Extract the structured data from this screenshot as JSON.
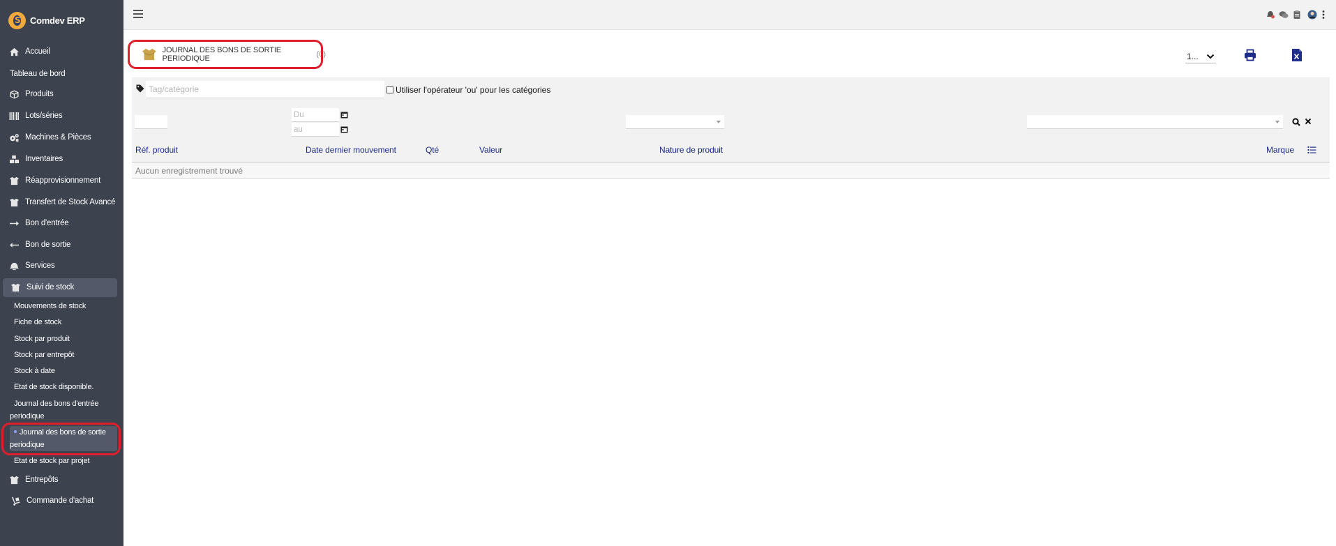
{
  "brand": {
    "name": "Comdev ERP"
  },
  "sidebar": {
    "items": [
      {
        "label": "Accueil",
        "icon": "home-icon"
      },
      {
        "label": "Tableau de bord",
        "icon": ""
      },
      {
        "label": "Produits",
        "icon": "cube-icon"
      },
      {
        "label": "Lots/séries",
        "icon": "barcode-icon"
      },
      {
        "label": "Machines & Pièces",
        "icon": "cogs-icon"
      },
      {
        "label": "Inventaires",
        "icon": "boxes-icon"
      },
      {
        "label": "Réapprovisionnement",
        "icon": "box-open-icon"
      },
      {
        "label": "Transfert de Stock Avancé",
        "icon": "box-open-icon"
      },
      {
        "label": "Bon d'entrée",
        "icon": "arrow-right-icon"
      },
      {
        "label": "Bon de sortie",
        "icon": "arrow-left-icon"
      },
      {
        "label": "Services",
        "icon": "bell-icon"
      },
      {
        "label": "Suivi de stock",
        "icon": "box-open-icon"
      },
      {
        "label": "Entrepôts",
        "icon": "box-open-icon"
      },
      {
        "label": "Commande d'achat",
        "icon": "dolly-icon"
      }
    ],
    "sub_items": [
      "Mouvements de stock",
      "Fiche de stock",
      "Stock par produit",
      "Stock par entrepôt",
      "Stock à date",
      "Etat de stock disponible.",
      "Journal des bons d'entrée periodique",
      "Journal des bons de sortie periodique",
      "Etat de stock par projet"
    ]
  },
  "page": {
    "title": "JOURNAL DES BONS DE SORTIE PERIODIQUE",
    "count": "(0)",
    "limit_value": "1..."
  },
  "filters": {
    "tag_placeholder": "Tag/catégorie",
    "or_operator_label": "Utiliser l'opérateur 'ou' pour les catégories",
    "date_from_placeholder": "Du",
    "date_to_placeholder": "au"
  },
  "table": {
    "columns": [
      "Réf. produit",
      "Date dernier mouvement",
      "Qté",
      "Valeur",
      "Nature de produit",
      "Marque"
    ],
    "empty_message": "Aucun enregistrement trouvé"
  },
  "colors": {
    "sidebar_bg": "#3d424f",
    "highlight": "#e01e2c",
    "column_header": "#1e2d8a",
    "icon_blue": "#1e2d8a",
    "box_icon": "#c9a24b"
  }
}
